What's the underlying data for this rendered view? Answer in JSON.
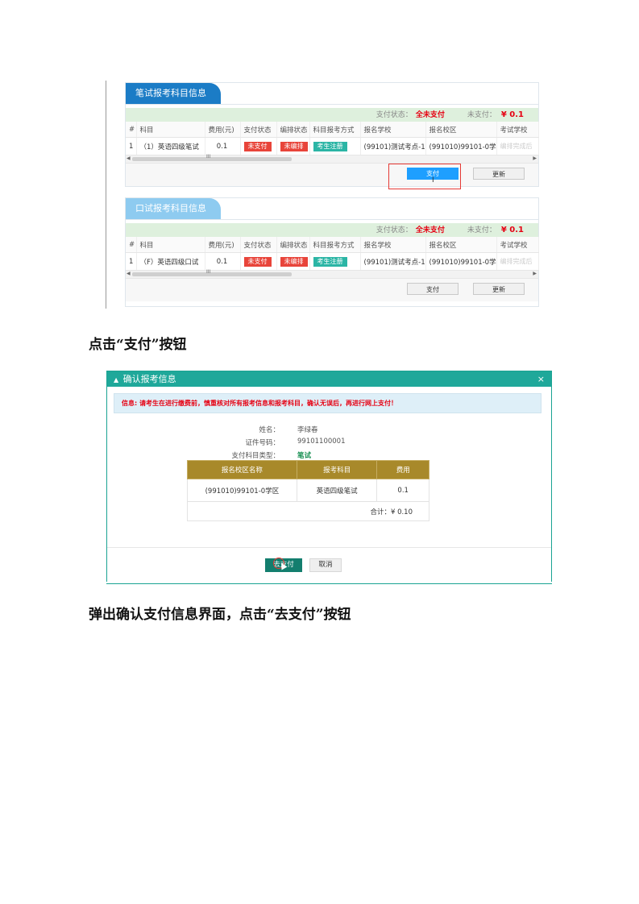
{
  "shot1": {
    "written_panel": {
      "title": "笔试报考科目信息",
      "status_label": "支付状态：",
      "status_value": "全未支付",
      "unpaid_label": "未支付：",
      "unpaid_amount": "¥ 0.1",
      "columns": [
        "#",
        "科目",
        "费用(元)",
        "支付状态",
        "编排状态",
        "科目报考方式",
        "报名学校",
        "报名校区",
        "考试学校"
      ],
      "row": {
        "index": "1",
        "subject": "（1）英语四级笔试",
        "fee": "0.1",
        "pay_status": "未支付",
        "arrange_status": "未编排",
        "method": "考生注册",
        "school": "(99101)测试考点-1",
        "campus": "(991010)99101-0学区",
        "exam_school": "编排完成后"
      },
      "pay_button": "支付",
      "refresh_button": "更新",
      "cursor_glyph": "I"
    },
    "oral_panel": {
      "title": "口试报考科目信息",
      "status_label": "支付状态：",
      "status_value": "全未支付",
      "unpaid_label": "未支付：",
      "unpaid_amount": "¥ 0.1",
      "columns": [
        "#",
        "科目",
        "费用(元)",
        "支付状态",
        "编排状态",
        "科目报考方式",
        "报名学校",
        "报名校区",
        "考试学校"
      ],
      "row": {
        "index": "1",
        "subject": "（F）英语四级口试",
        "fee": "0.1",
        "pay_status": "未支付",
        "arrange_status": "未编排",
        "method": "考生注册",
        "school": "(99101)测试考点-1",
        "campus": "(991010)99101-0学区",
        "exam_school": "编排完成后"
      },
      "pay_button": "支付",
      "refresh_button": "更新"
    },
    "scroll_grip": "III"
  },
  "caption1": "点击“支付”按钮",
  "dialog": {
    "title": "确认报考信息",
    "close": "×",
    "info": "信息: 请考生在进行缴费前，慎重核对所有报考信息和报考科目，确认无误后，再进行网上支付！",
    "fields": [
      {
        "label": "姓名：",
        "value": "李绿春"
      },
      {
        "label": "证件号码：",
        "value": "99101100001"
      },
      {
        "label": "支付科目类型：",
        "value": "笔试"
      }
    ],
    "table": {
      "headers": [
        "报名校区名称",
        "报考科目",
        "费用"
      ],
      "row": [
        "(991010)99101-0学区",
        "英语四级笔试",
        "0.1"
      ],
      "total": "合计：¥ 0.10"
    },
    "go_pay_button": "去支付",
    "cancel_button": "取消"
  },
  "caption2": "弹出确认支付信息界面，点击“去支付”按钮",
  "colors": {
    "panel_blue": "#1b7cc6",
    "panel_light_blue": "#8ecbf0",
    "status_red": "#e60012",
    "tag_red": "#e8443a",
    "tag_teal": "#2bb5a5",
    "pay_blue": "#1e9fff",
    "dialog_teal": "#1fa89a",
    "table_header_gold": "#a8892a",
    "highlight_red": "#e53935"
  },
  "icons": {
    "dialog_title_icon": "warning-triangle-icon",
    "close": "close-icon"
  }
}
